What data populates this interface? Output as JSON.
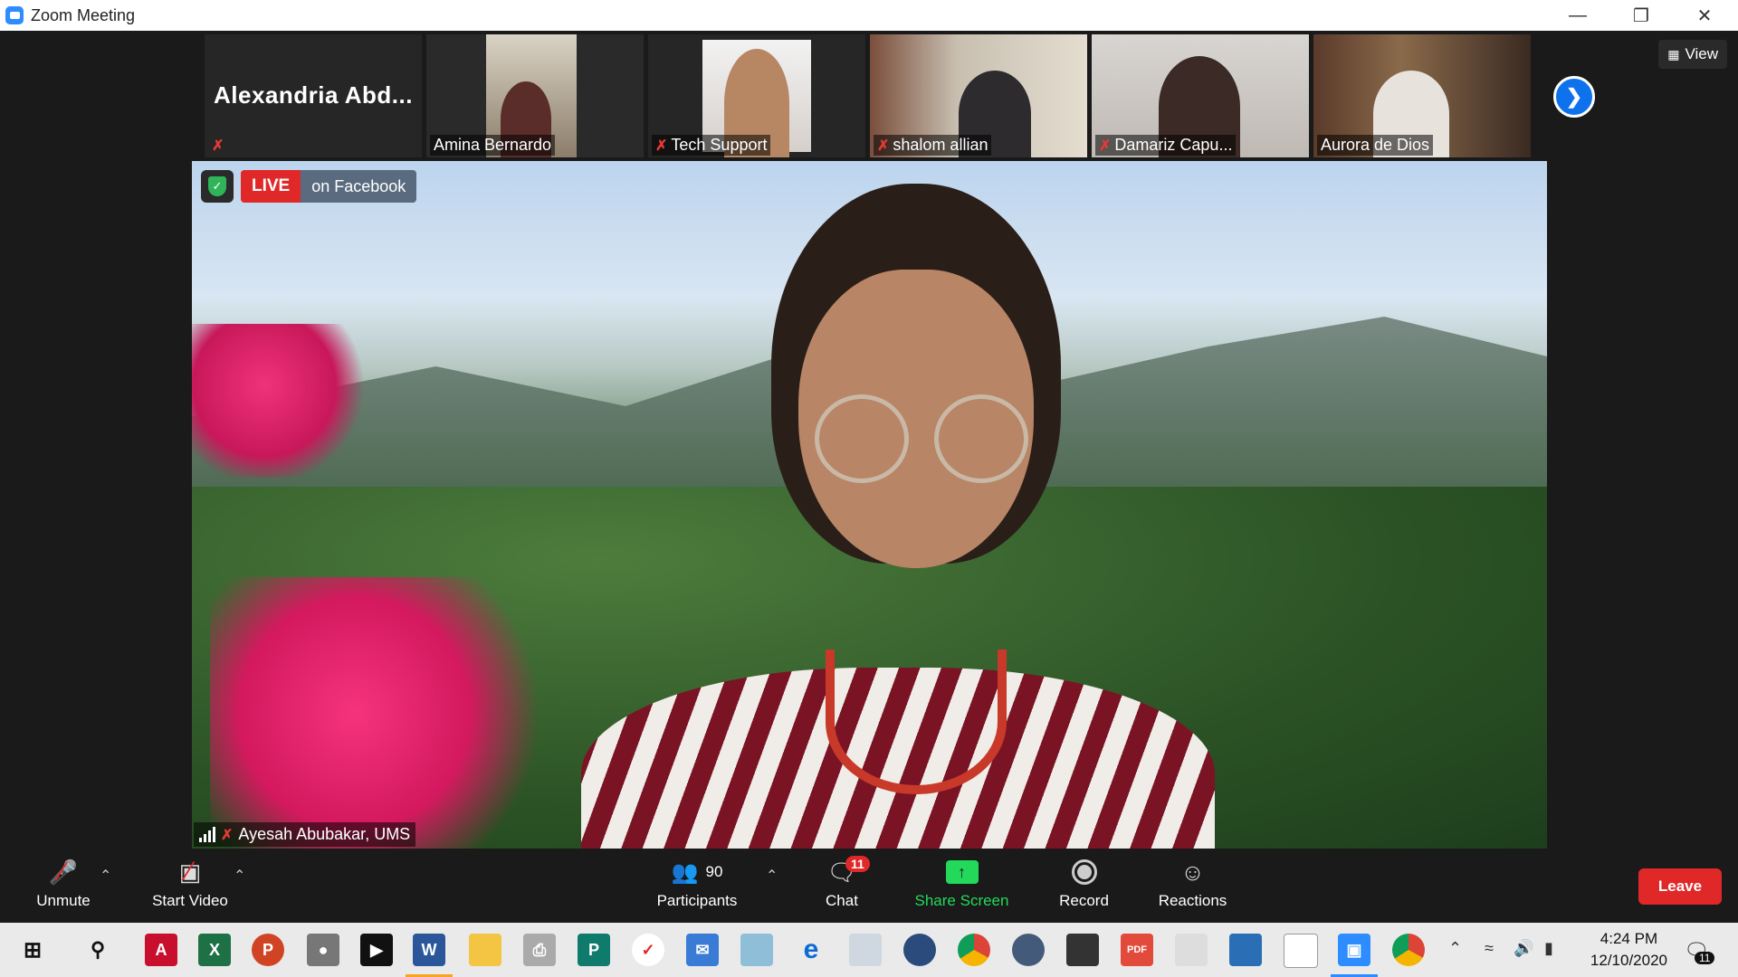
{
  "window": {
    "title": "Zoom Meeting",
    "minimize_icon": "minimize-icon",
    "maximize_icon": "restore-icon",
    "close_icon": "close-icon"
  },
  "gallery": {
    "participants": [
      {
        "name": "Alexandria  Abd...",
        "muted": true,
        "video": false
      },
      {
        "name": "Amina Bernardo",
        "muted": false,
        "video": true
      },
      {
        "name": "Tech Support",
        "muted": true,
        "video": true
      },
      {
        "name": "shalom allian",
        "muted": true,
        "video": true
      },
      {
        "name": "Damariz Capu...",
        "muted": true,
        "video": true
      },
      {
        "name": "Aurora de Dios",
        "muted": false,
        "video": true
      }
    ],
    "view_label": "View"
  },
  "main": {
    "live_label": "LIVE",
    "platform_label": "on Facebook",
    "speaker_name": "Ayesah Abubakar, UMS"
  },
  "toolbar": {
    "unmute_label": "Unmute",
    "start_video_label": "Start Video",
    "participants_label": "Participants",
    "participants_count": "90",
    "chat_label": "Chat",
    "chat_badge": "11",
    "share_label": "Share Screen",
    "record_label": "Record",
    "reactions_label": "Reactions",
    "leave_label": "Leave",
    "colors": {
      "share": "#23d959",
      "leave": "#e02828",
      "badge": "#e02828"
    }
  },
  "taskbar": {
    "time": "4:24 PM",
    "date": "12/10/2020",
    "notification_count": "11",
    "apps": [
      "windows-start-icon",
      "search-icon",
      "acrobat-icon",
      "excel-icon",
      "powerpoint-icon",
      "podcast-icon",
      "media-icon",
      "word-icon",
      "file-explorer-icon",
      "printer-icon",
      "publisher-icon",
      "tasks-icon",
      "outlook-icon",
      "notes-icon",
      "edge-icon",
      "images-icon",
      "vpn-icon",
      "chrome-icon",
      "library-icon",
      "store-icon",
      "pdf-icon",
      "doc-icon",
      "photos-icon",
      "grammar-icon",
      "zoom-icon",
      "chrome-profile-icon"
    ]
  }
}
